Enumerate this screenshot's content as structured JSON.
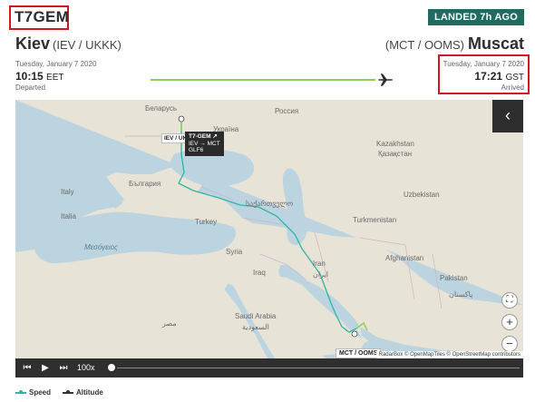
{
  "flight": {
    "callsign": "T7GEM",
    "status": "LANDED 7h AGO"
  },
  "origin": {
    "city": "Kiev",
    "codes": "(IEV / UKKK)",
    "date": "Tuesday, January 7 2020",
    "time": "10:15",
    "tz": "EET",
    "label": "Departed"
  },
  "destination": {
    "city": "Muscat",
    "codes": "(MCT / OOMS)",
    "date": "Tuesday, January 7 2020",
    "time": "17:21",
    "tz": "GST",
    "label": "Arrived"
  },
  "map": {
    "tooltip": {
      "callsign": "T7-GEM ↗",
      "route": "IEV → MCT",
      "type": "GLF6"
    },
    "origin_tag": "IEV / UKK",
    "dest_tag": "MCT / OOMS",
    "attribution": "RadarBox © OpenMapTiles © OpenStreetMap contributors",
    "labels": {
      "kazakhstan_latin": "Kazakhstan",
      "kazakhstan_cyr": "Қазақстан",
      "uzbekistan": "Uzbekistan",
      "turkmenistan": "Turkmenistan",
      "afghanistan": "Afghanistan",
      "pakistan": "Pakistan",
      "pakistan_ur": "پاکستان",
      "iran": "Iran",
      "iran_fa": "ایران",
      "iraq": "Iraq",
      "syria": "Syria",
      "turkey": "Turkey",
      "saudi": "Saudi Arabia",
      "saudi_ar": "السعودية",
      "egypt_ar": "مصر",
      "italy": "Italy",
      "italia": "Italia",
      "bulgaria": "България",
      "belarus": "Беларусь",
      "ukraine": "Україна",
      "russia": "Россия",
      "sakartvelo": "საქართველო",
      "mediterranean": "Μεσόγειος"
    },
    "controls": {
      "collapse": "‹",
      "fullscreen": "⛶",
      "zoom_in": "+",
      "zoom_out": "−"
    },
    "colors": {
      "route_speed": "#2eb5a3",
      "route_end": "#8fd052",
      "water": "#bcd4df",
      "land": "#e7e3d6"
    }
  },
  "playback": {
    "rewind": "⏮",
    "play": "▶",
    "forward": "⏭",
    "speed": "100x"
  },
  "legend": {
    "speed": "Speed",
    "altitude": "Altitude"
  }
}
